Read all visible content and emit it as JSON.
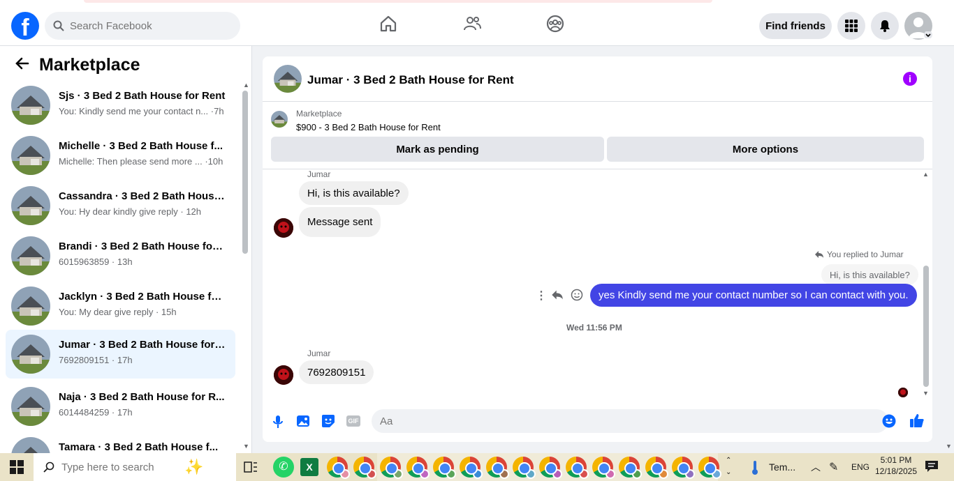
{
  "topbar": {
    "search_placeholder": "Search Facebook",
    "find_friends": "Find friends"
  },
  "sidebar": {
    "title": "Marketplace",
    "conversations": [
      {
        "name": "Sjs · 3 Bed 2 Bath House for Rent",
        "snippet": "You: Kindly send me your contact n... ·7h"
      },
      {
        "name": "Michelle · 3 Bed 2 Bath House f...",
        "snippet": "Michelle: Then please send more ... ·10h"
      },
      {
        "name": "Cassandra · 3 Bed 2 Bath House ...",
        "snippet": "You: Hy dear kindly give reply · 12h"
      },
      {
        "name": "Brandi · 3 Bed 2 Bath House for ...",
        "snippet": "6015963859 · 13h"
      },
      {
        "name": "Jacklyn · 3 Bed 2 Bath House for...",
        "snippet": "You: My dear give reply · 15h"
      },
      {
        "name": "Jumar · 3 Bed 2 Bath House for ...",
        "snippet": "7692809151 · 17h"
      },
      {
        "name": "Naja · 3 Bed 2 Bath House for R...",
        "snippet": "6014484259 · 17h"
      },
      {
        "name": "Tamara · 3 Bed 2 Bath House f...",
        "snippet": ""
      }
    ]
  },
  "chat": {
    "title": "Jumar · 3 Bed 2 Bath House for Rent",
    "listing_source": "Marketplace",
    "listing_price": "$900 - 3 Bed 2 Bath House for Rent",
    "mark_pending": "Mark as pending",
    "more_options": "More options",
    "messages": {
      "sender1": "Jumar",
      "msg1": "Hi, is this available?",
      "msg2": "Message sent",
      "reply_label": "You replied to Jumar",
      "reply_quote": "Hi, is this available?",
      "my_msg": "yes Kindly send me your contact number so I can contact with you.",
      "timestamp": "Wed 11:56 PM",
      "sender2": "Jumar",
      "msg3": "7692809151"
    },
    "composer_placeholder": "Aa",
    "colors": {
      "accent": "#0866ff",
      "my_bubble": "#4245e5",
      "info": "#a000ff"
    }
  },
  "taskbar": {
    "search_placeholder": "Type here to search",
    "weather": "Tem...",
    "language": "ENG",
    "time": "5:01 PM",
    "date": "12/18/2025"
  }
}
